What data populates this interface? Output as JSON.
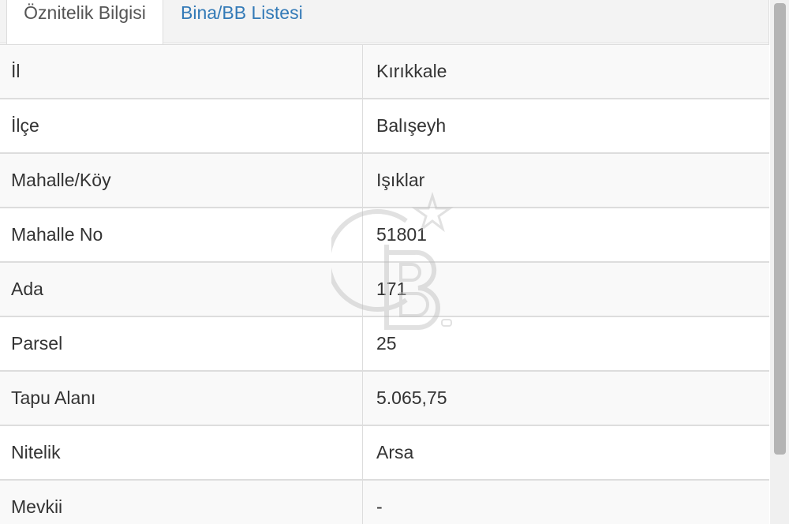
{
  "tabs": [
    {
      "label": "Öznitelik Bilgisi",
      "active": true
    },
    {
      "label": "Bina/BB Listesi",
      "active": false
    }
  ],
  "attributes": [
    {
      "label": "İl",
      "value": "Kırıkkale"
    },
    {
      "label": "İlçe",
      "value": "Balışeyh"
    },
    {
      "label": "Mahalle/Köy",
      "value": "Işıklar"
    },
    {
      "label": "Mahalle No",
      "value": "51801"
    },
    {
      "label": "Ada",
      "value": "171"
    },
    {
      "label": "Parsel",
      "value": "25"
    },
    {
      "label": "Tapu Alanı",
      "value": "5.065,75"
    },
    {
      "label": "Nitelik",
      "value": "Arsa"
    },
    {
      "label": "Mevkii",
      "value": "-"
    }
  ],
  "colors": {
    "tab_link": "#337ab7",
    "text": "#333333",
    "border": "#dddddd",
    "stripe": "#f9f9f9"
  }
}
